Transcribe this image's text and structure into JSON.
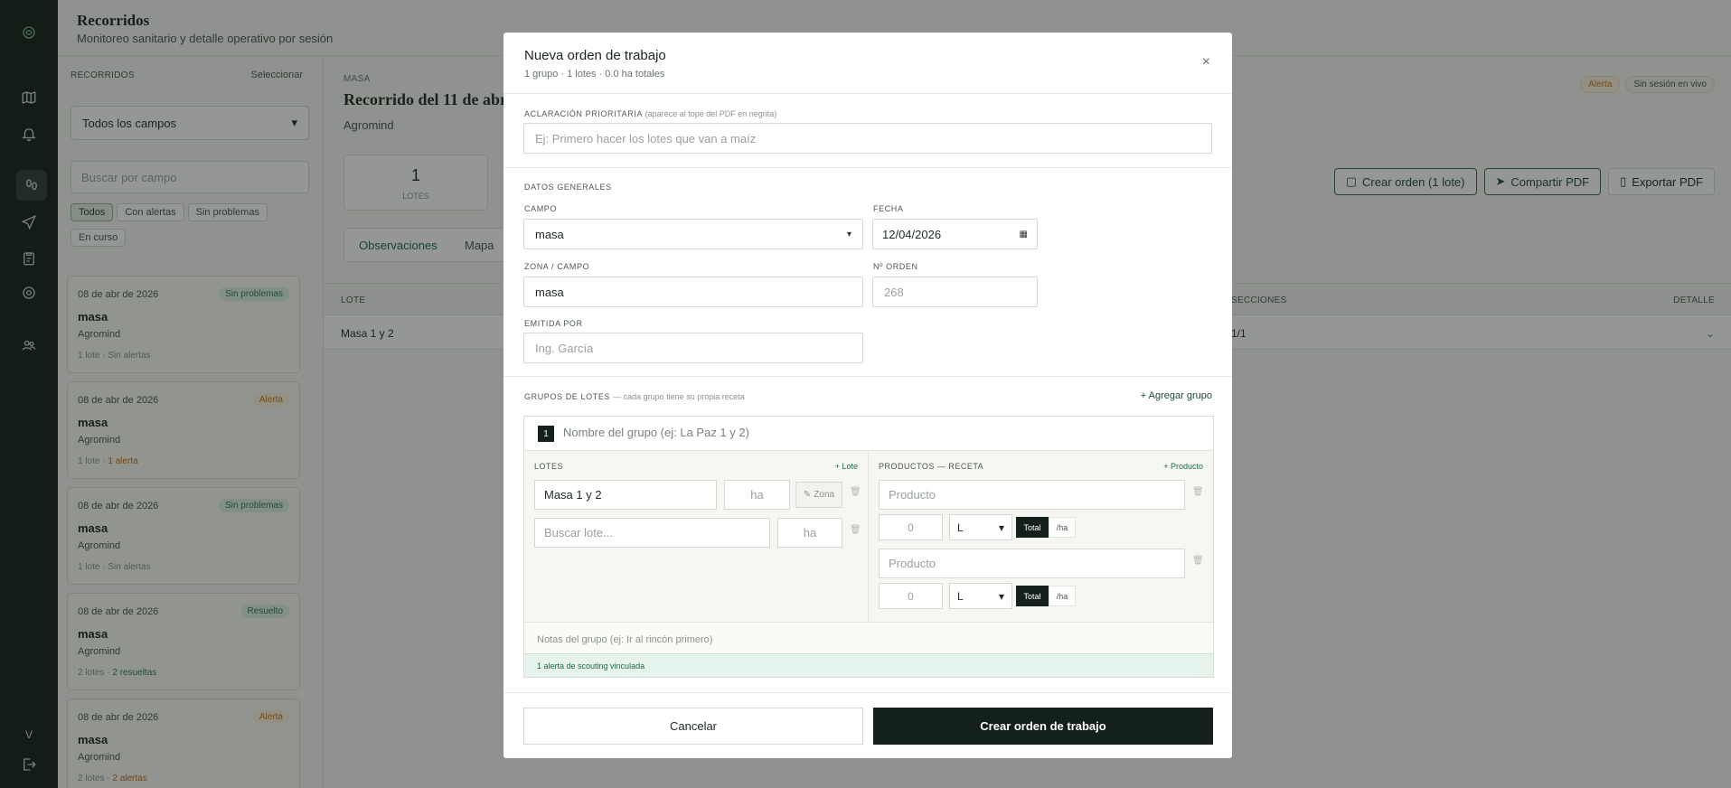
{
  "app": {
    "title": "Recorridos",
    "subtitle": "Monitoreo sanitario y detalle operativo por sesión",
    "footer_glyph": "V"
  },
  "sidebar": {
    "label": "RECORRIDOS",
    "select_link": "Seleccionar",
    "campo_filter": "Todos los campos",
    "search_placeholder": "Buscar por campo",
    "chips": [
      "Todos",
      "Con alertas",
      "Sin problemas",
      "En curso"
    ],
    "cards": [
      {
        "date": "08 de abr de 2026",
        "badge": "Sin problemas",
        "badge_type": "ok",
        "title": "masa",
        "company": "Agromind",
        "lotes": "1 lote",
        "status": "Sin alertas",
        "status_type": "muted"
      },
      {
        "date": "08 de abr de 2026",
        "badge": "Alerta",
        "badge_type": "al",
        "title": "masa",
        "company": "Agromind",
        "lotes": "1 lote",
        "status": "1 alerta",
        "status_type": "warn"
      },
      {
        "date": "08 de abr de 2026",
        "badge": "Sin problemas",
        "badge_type": "ok",
        "title": "masa",
        "company": "Agromind",
        "lotes": "1 lote",
        "status": "Sin alertas",
        "status_type": "muted"
      },
      {
        "date": "08 de abr de 2026",
        "badge": "Resuelto",
        "badge_type": "ok",
        "title": "masa",
        "company": "Agromind",
        "lotes": "2 lotes",
        "status": "2 resueltas",
        "status_type": "good"
      },
      {
        "date": "08 de abr de 2026",
        "badge": "Alerta",
        "badge_type": "al",
        "title": "masa",
        "company": "Agromind",
        "lotes": "2 lotes",
        "status": "2 alertas",
        "status_type": "warn"
      }
    ]
  },
  "main": {
    "eyebrow": "MASA",
    "title": "Recorrido del 11 de abril",
    "org": "Agromind",
    "badges": [
      "Alerta",
      "Sin sesión en vivo"
    ],
    "stat": {
      "value": "1",
      "label": "LOTES"
    },
    "actions": [
      "Crear orden (1 lote)",
      "Compartir PDF",
      "Exportar PDF"
    ],
    "tabs": [
      "Observaciones",
      "Mapa"
    ],
    "columns": [
      "LOTE",
      "SECCIONES",
      "DETALLE"
    ],
    "row": {
      "lote": "Masa 1 y 2",
      "secciones": "1/1"
    }
  },
  "modal": {
    "title": "Nueva orden de trabajo",
    "subtitle": "1 grupo · 1 lotes · 0.0 ha totales",
    "close": "×",
    "priority": {
      "label": "ACLARACIÓN PRIORITARIA",
      "hint": "(aparece al tope del PDF en negrita)",
      "placeholder": "Ej: Primero hacer los lotes que van a maíz"
    },
    "general": {
      "label": "DATOS GENERALES",
      "campo_label": "CAMPO",
      "campo_value": "masa",
      "fecha_label": "FECHA",
      "fecha_value": "12/04/2026",
      "zona_label": "ZONA / CAMPO",
      "zona_value": "masa",
      "orden_label": "Nº ORDEN",
      "orden_value": "268",
      "emitida_label": "EMITIDA POR",
      "emitida_placeholder": "Ing. García"
    },
    "groups": {
      "label": "GRUPOS DE LOTES",
      "hint": "— cada grupo tiene su propia receta",
      "add_group": "+ Agregar grupo",
      "group_number": "1",
      "group_name_placeholder": "Nombre del grupo (ej: La Paz 1 y 2)",
      "lotes_label": "LOTES",
      "add_lote": "+ Lote",
      "lote_value": "Masa 1 y 2",
      "ha_placeholder": "ha",
      "zona_btn": "Zona",
      "search_lote_placeholder": "Buscar lote...",
      "productos_label": "PRODUCTOS — RECETA",
      "add_producto": "+ Producto",
      "products": [
        {
          "placeholder": "Producto",
          "qty": "0",
          "unit": "L",
          "mode_on": "Total",
          "mode_off": "/ha"
        },
        {
          "placeholder": "Producto",
          "qty": "0",
          "unit": "L",
          "mode_on": "Total",
          "mode_off": "/ha"
        }
      ],
      "notes_placeholder": "Notas del grupo (ej: Ir al rincón primero)",
      "alert_link": "1 alerta de scouting vinculada"
    },
    "cancel": "Cancelar",
    "submit": "Crear orden de trabajo"
  },
  "colors": {
    "dark": "#14201b",
    "accent": "#1f6b44",
    "alert": "#c07a1e",
    "ok": "#2f7a4e"
  }
}
